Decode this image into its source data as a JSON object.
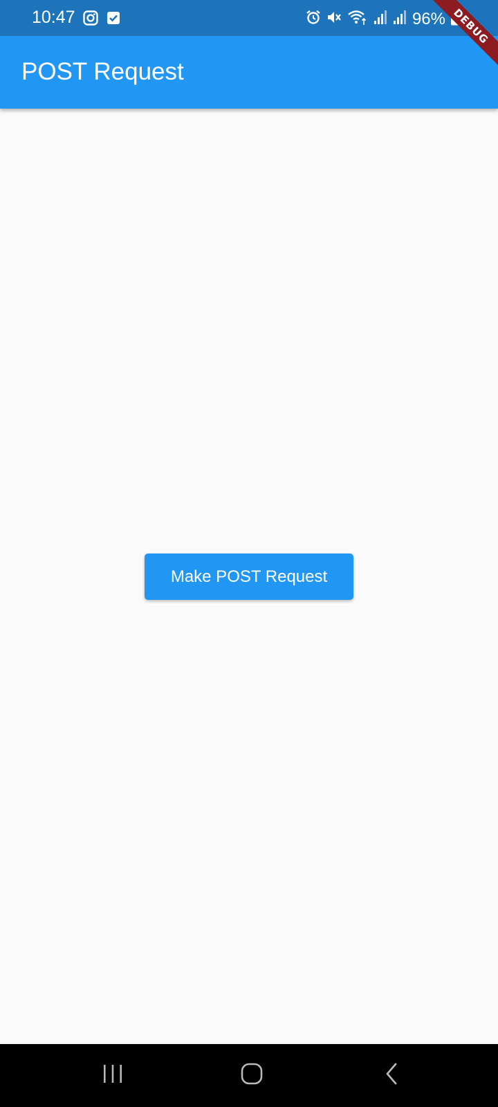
{
  "status_bar": {
    "time": "10:47",
    "battery": "96%",
    "left_icons": [
      "instagram-icon",
      "check-box-icon"
    ],
    "right_icons": [
      "alarm-icon",
      "mute-icon",
      "wifi-icon",
      "signal-icon",
      "signal-icon",
      "battery-charging-icon"
    ],
    "color": "#1e74bb"
  },
  "app_bar": {
    "title": "POST Request",
    "color": "#2196f3"
  },
  "debug_banner": {
    "label": "DEBUG",
    "color": "#8c1b22"
  },
  "main": {
    "button_label": "Make POST Request",
    "button_color": "#2196f3"
  },
  "nav_bar": {
    "buttons": [
      "recent-apps-icon",
      "home-icon",
      "back-icon"
    ]
  }
}
